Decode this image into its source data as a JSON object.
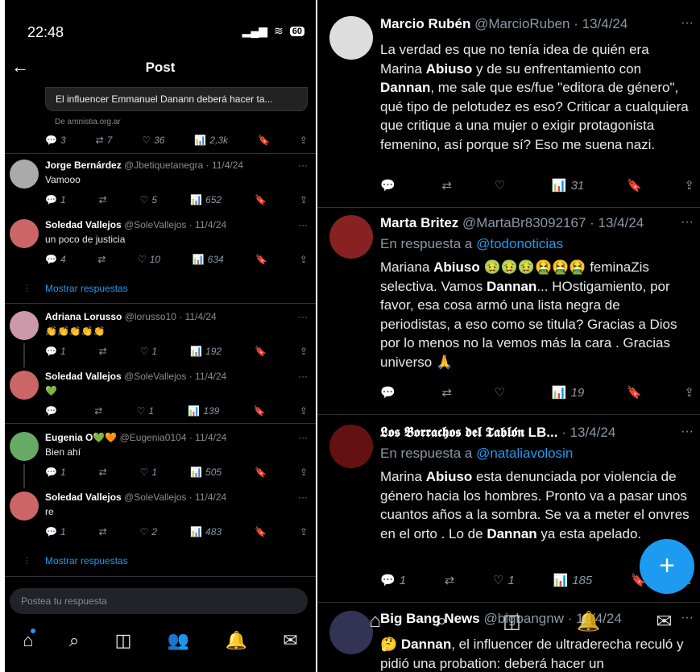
{
  "status": {
    "time": "22:48",
    "battery": "60"
  },
  "header": {
    "title": "Post",
    "back": "←"
  },
  "card": {
    "text": "El influencer Emmanuel Danann deberá hacer ta...",
    "source": "De amnistia.org.ar"
  },
  "card_actions": {
    "replies": "3",
    "retweets": "7",
    "likes": "36",
    "views": "2,3k"
  },
  "left_posts": [
    {
      "name": "Jorge Bernárdez",
      "handle": "@Jbetiquetanegra · 11/4/24",
      "text": "Vamooo",
      "replies": "1",
      "retweets": "",
      "likes": "5",
      "views": "652"
    },
    {
      "name": "Soledad Vallejos",
      "handle": "@SoleVallejos · 11/4/24",
      "text": "un poco de justicia",
      "replies": "4",
      "retweets": "",
      "likes": "10",
      "views": "634"
    },
    {
      "name": "Adriana Lorusso",
      "handle": "@lorusso10 · 11/4/24",
      "text": "👏👏👏👏👏",
      "replies": "1",
      "retweets": "",
      "likes": "1",
      "views": "192"
    },
    {
      "name": "Soledad Vallejos",
      "handle": "@SoleVallejos · 11/4/24",
      "text": "💚",
      "replies": "",
      "retweets": "",
      "likes": "1",
      "views": "139"
    },
    {
      "name": "Eugenia O💚🧡",
      "handle": "@Eugenia0104 · 11/4/24",
      "text": "Bien ahí",
      "replies": "1",
      "retweets": "",
      "likes": "1",
      "views": "505"
    },
    {
      "name": "Soledad Vallejos",
      "handle": "@SoleVallejos · 11/4/24",
      "text": "re",
      "replies": "1",
      "retweets": "",
      "likes": "2",
      "views": "483"
    }
  ],
  "show_replies": "Mostrar respuestas",
  "reply_placeholder": "Postea tu respuesta",
  "right_posts": [
    {
      "name": "Marcio Rubén",
      "handle": "@MarcioRuben · 13/4/24",
      "reply_to": "",
      "text": "La verdad es que no tenía idea de quién era Marina <b>Abiuso</b> y de su enfrentamiento con <b>Dannan</b>, me sale que es/fue \"editora de género\", qué tipo de pelotudez es eso? Criticar a cualquiera que critique  a una mujer o exigir protagonista femenino, así porque sí? Eso me suena nazi.",
      "replies": "",
      "retweets": "",
      "likes": "",
      "views": "31"
    },
    {
      "name": "Marta Britez",
      "handle": "@MartaBr83092167 · 13/4/24",
      "reply_to": "@todonoticias",
      "text": "Mariana <b>Abiuso</b> 🤢🤢🤢🤮🤮🤮  feminaZis selectiva. Vamos <b>Dannan</b>... HOstigamiento, por favor, esa cosa armó una lista negra de periodistas, a eso como se titula? Gracias a Dios por lo menos no la vemos más la cara . Gracias universo 🙏",
      "replies": "",
      "retweets": "",
      "likes": "",
      "views": "19"
    },
    {
      "name": "𝕷𝖔𝖘 𝕭𝖔𝖗𝖗𝖆𝖈𝖍𝖔𝖘 𝖉𝖊𝖑 𝕿𝖆𝖇𝖑𝖔́𝖓 LB...",
      "handle": "· 13/4/24",
      "reply_to": "@nataliavolosin",
      "text": "Marina <b>Abiuso</b> esta denunciada por violencia de género hacia los hombres. Pronto  va a pasar unos cuantos años a la sombra. Se va a meter el onvres en el orto . Lo de <b>Dannan</b> ya esta apelado.",
      "replies": "1",
      "retweets": "",
      "likes": "1",
      "views": "185"
    },
    {
      "name": "Big Bang News",
      "handle": "@bigbangnw · 12/4/24",
      "reply_to": "",
      "text": "🤔 <b>Dannan</b>, el influencer de ultraderecha reculó y pidió una probation: deberá hacer un",
      "replies": "",
      "retweets": "",
      "likes": "",
      "views": ""
    }
  ],
  "reply_prefix": "En respuesta a",
  "colors": {
    "accent": "#1d9bf0",
    "bg": "#000000"
  }
}
